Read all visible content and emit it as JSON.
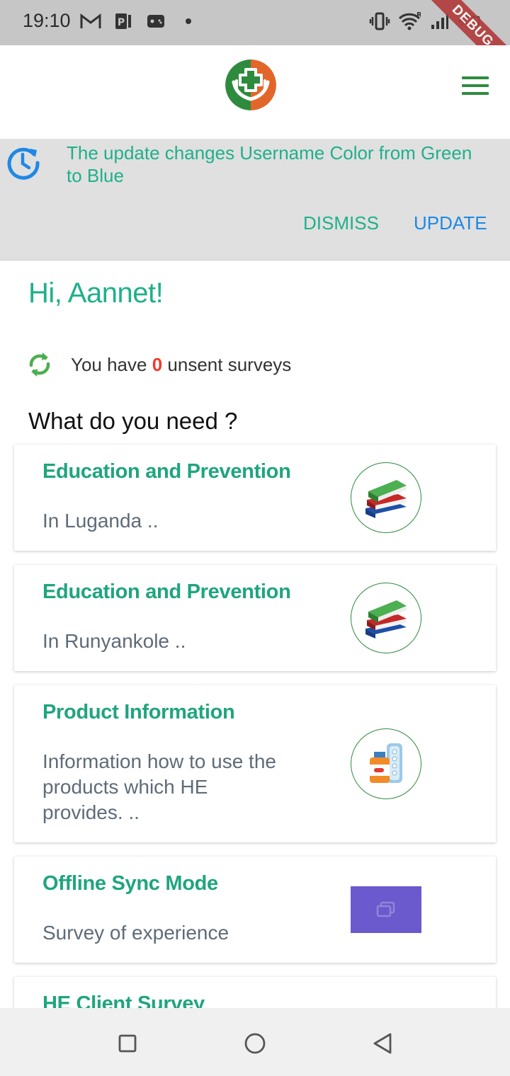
{
  "status_bar": {
    "time": "19:10",
    "debug_label": "DEBUG",
    "left_icons": [
      "gmail-icon",
      "parking-icon",
      "gamepad-icon",
      "dot-icon"
    ],
    "right_icons": [
      "vibrate-icon",
      "wifi-icon",
      "signal-icon",
      "battery-icon"
    ]
  },
  "app_bar": {
    "logo": "health-hands-logo",
    "menu_icon": "hamburger-menu-icon"
  },
  "update_banner": {
    "message": "The update changes Username Color from Green to Blue",
    "dismiss_label": "DISMISS",
    "update_label": "UPDATE"
  },
  "greeting": "Hi, Aannet!",
  "sync": {
    "prefix": "You have",
    "count": "0",
    "suffix": "unsent surveys"
  },
  "section_title": "What do you need ?",
  "cards": [
    {
      "title": "Education and Prevention",
      "subtitle": "In Luganda ..",
      "icon": "books-icon"
    },
    {
      "title": "Education and Prevention",
      "subtitle": "In Runyankole ..",
      "icon": "books-icon"
    },
    {
      "title": "Product Information",
      "subtitle": "Information how to use the products which HE provides. ..",
      "icon": "medicine-icon"
    },
    {
      "title": "Offline Sync Mode",
      "subtitle": "Survey of experience",
      "icon": "image-placeholder-icon"
    },
    {
      "title": "HE Client Survey",
      "subtitle": "",
      "icon": ""
    }
  ],
  "colors": {
    "accent": "#1fb08a",
    "title_green": "#1fa57e",
    "update_blue": "#1e88e5",
    "count_red": "#f03a2e",
    "banner_bg": "#e0e0e0",
    "placeholder_purple": "#6a5acd"
  }
}
